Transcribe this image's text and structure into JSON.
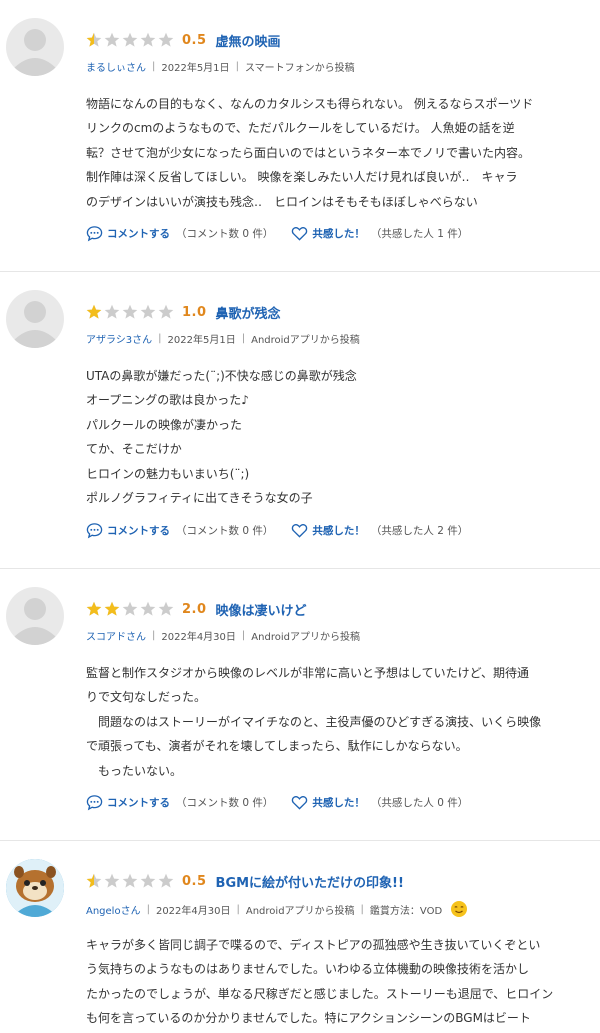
{
  "reviews": [
    {
      "stars": [
        0.5,
        0,
        0,
        0,
        0
      ],
      "score": "0.5",
      "title": "虚無の映画",
      "user": "まるしぃさん",
      "date": "2022年5月1日",
      "source": "スマートフォンから投稿",
      "body": [
        "物語になんの目的もなく、なんのカタルシスも得られない。 例えるならスポーツド",
        "リンクのcmのようなもので、ただパルクールをしているだけ。 人魚姫の話を逆",
        "転？させて泡が少女になったら面白いのではというネター本でノリで書いた内容。",
        "制作陣は深く反省してほしい。 映像を楽しみたい人だけ見れば良いが‥　キャラ",
        "のデザインはいいが演技も残念‥　ヒロインはそもそもほぼしゃべらない"
      ],
      "comment_label": "コメントする",
      "comment_count": "（コメント数 0 件）",
      "like_label": "共感した！",
      "like_count": "（共感した人 1 件）"
    },
    {
      "stars": [
        1,
        0,
        0,
        0,
        0
      ],
      "score": "1.0",
      "title": "鼻歌が残念",
      "user": "アザラシ3さん",
      "date": "2022年5月1日",
      "source": "Androidアプリから投稿",
      "body": [
        "UTAの鼻歌が嫌だった(¨;)不快な感じの鼻歌が残念",
        "オープニングの歌は良かった♪",
        "パルクールの映像が凄かった",
        "てか、そこだけか",
        "ヒロインの魅力もいまいち(¨;)",
        "ポルノグラフィティに出てきそうな女の子"
      ],
      "comment_label": "コメントする",
      "comment_count": "（コメント数 0 件）",
      "like_label": "共感した！",
      "like_count": "（共感した人 2 件）"
    },
    {
      "stars": [
        1,
        1,
        0,
        0,
        0
      ],
      "score": "2.0",
      "title": "映像は凄いけど",
      "user": "スコアドさん",
      "date": "2022年4月30日",
      "source": "Androidアプリから投稿",
      "body": [
        "監督と制作スタジオから映像のレベルが非常に高いと予想はしていたけど、期待通",
        "りで文句なしだった。",
        "　問題なのはストーリーがイマイチなのと、主役声優のひどすぎる演技、いくら映像",
        "で頑張っても、演者がそれを壊してしまったら、駄作にしかならない。",
        "　もったいない。"
      ],
      "comment_label": "コメントする",
      "comment_count": "（コメント数 0 件）",
      "like_label": "共感した！",
      "like_count": "（共感した人 0 件）"
    },
    {
      "stars": [
        0.5,
        0,
        0,
        0,
        0
      ],
      "score": "0.5",
      "title": "BGMに絵が付いただけの印象!!",
      "user": "Angeloさん",
      "date": "2022年4月30日",
      "source": "Androidアプリから投稿",
      "method": "鑑賞方法：VOD",
      "mood_icon": "smiling-face-icon",
      "body": [
        "キャラが多く皆同じ調子で喋るので、ディストピアの孤独感や生き抜いていくぞとい",
        "う気持ちのようなものはありませんでした。いわゆる立体機動の映像技術を活かし",
        "たかったのでしょうが、単なる尺稼ぎだと感じました。ストーリーも退屈で、ヒロイン",
        "も何を言っているのか分かりませんでした。特にアクションシーンのBGMはビート"
      ]
    }
  ],
  "colors": {
    "accent_blue": "#1f63b3",
    "score_orange": "#e0871d",
    "star_gold": "#f3bd1c",
    "star_gray": "#cccccc"
  }
}
